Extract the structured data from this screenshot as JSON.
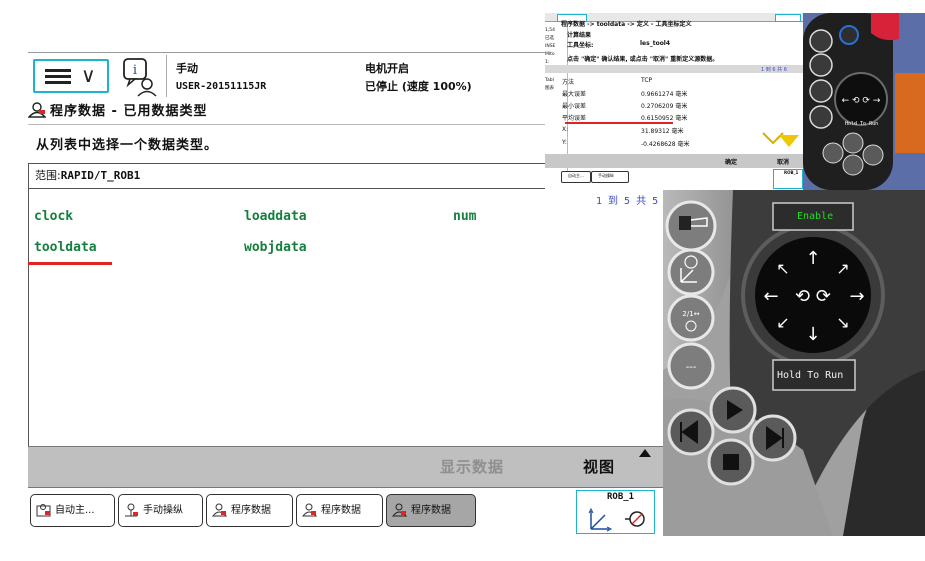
{
  "header": {
    "mode": "手动",
    "controller": "USER-20151115JR",
    "motor_status": "电机开启",
    "run_status": "已停止 (速度 100%)"
  },
  "page": {
    "title": "程序数据 - 已用数据类型",
    "instruction": "从列表中选择一个数据类型。",
    "scope_label": "范围:",
    "scope_value": "RAPID/T_ROB1",
    "page_count": "1 到 5 共 5"
  },
  "datatypes": [
    "clock",
    "loaddata",
    "num",
    "tooldata",
    "wobjdata"
  ],
  "commands": {
    "show_data": "显示数据",
    "view": "视图"
  },
  "taskbar": {
    "items": [
      "自动主...",
      "手动操纵",
      "程序数据",
      "程序数据",
      "程序数据"
    ],
    "robot": "ROB_1"
  },
  "inset": {
    "breadcrumb": "程序数据 -> tooldata -> 定义 - 工具坐标定义",
    "result_title": "计算结果",
    "tool_label": "工具坐标:",
    "tool_value": "les_tool4",
    "hint": "点击 \"确定\" 确认结果, 或点击 \"取消\" 重新定义源数据。",
    "page": "1 到 6 共 6",
    "col_method": "方法",
    "col_tcp": "TCP",
    "rows": [
      {
        "label": "最大误差",
        "value": "0.9661274 毫米"
      },
      {
        "label": "最小误差",
        "value": "0.2706209 毫米"
      },
      {
        "label": "平均误差",
        "value": "0.6150952 毫米"
      },
      {
        "label": "X:",
        "value": "31.89312 毫米"
      },
      {
        "label": "Y:",
        "value": "-0.4268628 毫米"
      }
    ],
    "ok": "确定",
    "cancel": "取消",
    "tasks": [
      "自动主...",
      "手动操纵"
    ],
    "robot": "ROB_1",
    "side_lines": [
      "1,54",
      "已选",
      "INSE",
      "Mlto",
      "1:",
      "Curr",
      "Tabl",
      "图表"
    ],
    "hold_to_run": "Hold To Run"
  },
  "pendant": {
    "enable": "Enable",
    "hold_to_run": "Hold To Run"
  },
  "colors": {
    "accent": "#1db4c9",
    "datatype_text": "#15803d",
    "underline": "#e02424",
    "enable_text": "#22dd22"
  }
}
